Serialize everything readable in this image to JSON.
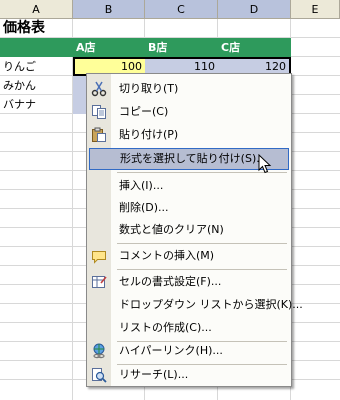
{
  "columns": [
    "A",
    "B",
    "C",
    "D",
    "E"
  ],
  "sheet": {
    "title": "価格表",
    "headers": [
      "A店",
      "B店",
      "C店"
    ],
    "rows": [
      {
        "name": "りんご",
        "values": [
          "100",
          "110",
          "120"
        ]
      },
      {
        "name": "みかん"
      },
      {
        "name": "バナナ"
      }
    ]
  },
  "context_menu": {
    "items": [
      {
        "label": "切り取り(T)",
        "icon": "scissors-icon"
      },
      {
        "label": "コピー(C)",
        "icon": "copy-icon"
      },
      {
        "label": "貼り付け(P)",
        "icon": "paste-icon"
      },
      {
        "label": "形式を選択して貼り付け(S)...",
        "highlighted": true
      },
      {
        "label": "挿入(I)..."
      },
      {
        "label": "削除(D)..."
      },
      {
        "label": "数式と値のクリア(N)"
      },
      {
        "label": "コメントの挿入(M)",
        "icon": "comment-icon"
      },
      {
        "label": "セルの書式設定(F)...",
        "icon": "format-cells-icon"
      },
      {
        "label": "ドロップダウン リストから選択(K)..."
      },
      {
        "label": "リストの作成(C)..."
      },
      {
        "label": "ハイパーリンク(H)...",
        "icon": "hyperlink-icon"
      },
      {
        "label": "リサーチ(L)...",
        "icon": "research-icon"
      }
    ]
  },
  "colors": {
    "header_green": "#2e9a5c",
    "selection": "#c6cde3",
    "highlight": "#b6bdd2"
  }
}
